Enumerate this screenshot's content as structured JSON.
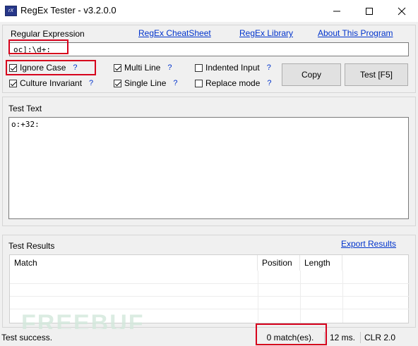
{
  "window": {
    "title": "RegEx Tester - v3.2.0.0",
    "app_icon_text": "rX",
    "buttons": [
      "minimize",
      "maximize",
      "close"
    ]
  },
  "regex_section": {
    "label": "Regular Expression",
    "links": [
      "RegEx CheatSheet",
      "RegEx Library",
      "About This Program"
    ],
    "value": "oc]:\\d+:"
  },
  "options": {
    "ignore_case": {
      "label": "Ignore Case",
      "checked": true,
      "help": "?"
    },
    "multi_line": {
      "label": "Multi Line",
      "checked": true,
      "help": "?"
    },
    "indented_input": {
      "label": "Indented Input",
      "checked": false,
      "help": "?"
    },
    "culture_invariant": {
      "label": "Culture Invariant",
      "checked": true,
      "help": "?"
    },
    "single_line": {
      "label": "Single Line",
      "checked": true,
      "help": "?"
    },
    "replace_mode": {
      "label": "Replace mode",
      "checked": false,
      "help": "?"
    }
  },
  "actions": {
    "copy_label": "Copy",
    "test_label": "Test [F5]"
  },
  "test_text": {
    "label": "Test Text",
    "value": "o:+32:"
  },
  "results": {
    "label": "Test Results",
    "export_label": "Export Results",
    "columns": [
      "Match",
      "Position",
      "Length"
    ],
    "rows": []
  },
  "status": {
    "message": "Test success.",
    "matches": "0 match(es).",
    "time": "12 ms.",
    "clr": "CLR 2.0"
  },
  "watermark": "FREEBUF",
  "colors": {
    "highlight": "#d6001c",
    "link": "#0033cc"
  },
  "icons": [
    "app-icon",
    "minimize-icon",
    "maximize-icon",
    "close-icon",
    "checkbox-icon"
  ]
}
